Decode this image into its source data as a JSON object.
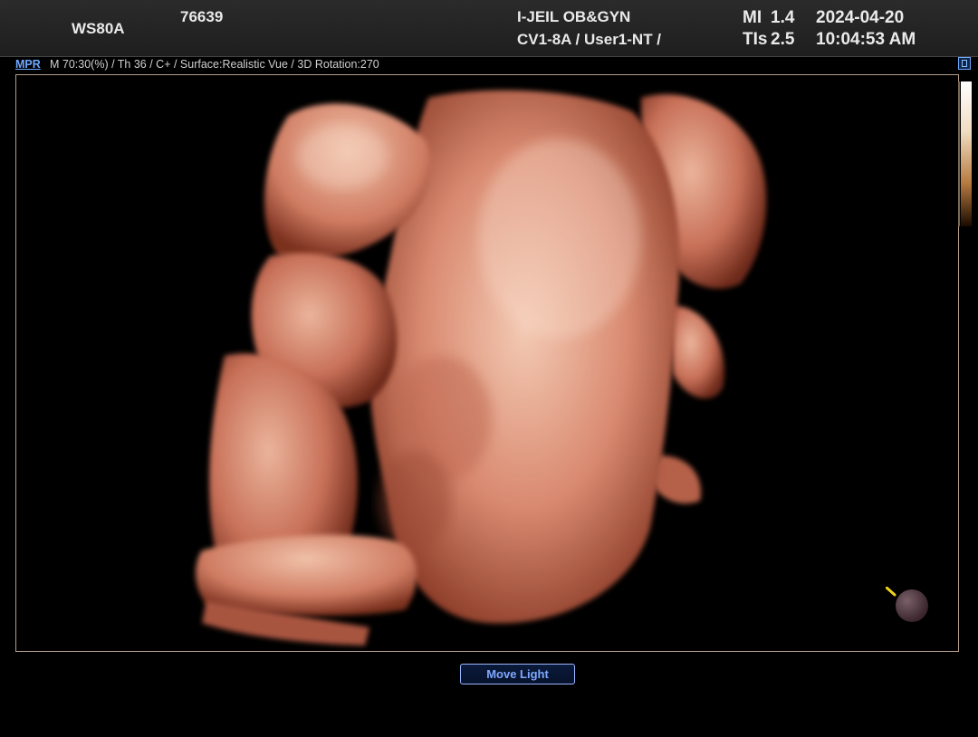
{
  "header": {
    "model": "WS80A",
    "patient_id": "76639",
    "institution": "I-JEIL OB&GYN",
    "probe_preset": "CV1-8A / User1-NT /",
    "mi_label": "MI",
    "mi_value": "1.4",
    "tis_label": "TIs",
    "tis_value": "2.5",
    "date": "2024-04-20",
    "time": "10:04:53 AM"
  },
  "info_bar": {
    "mode": "MPR",
    "params": "M 70:30(%) / Th 36 / C+ / Surface:Realistic Vue / 3D Rotation:270"
  },
  "icons": {
    "corner": "window-toggle-icon",
    "light": "light-source-icon"
  },
  "footer": {
    "button_label": "Move Light"
  },
  "colors": {
    "accent": "#6ea8ff",
    "header_bg": "#262626",
    "skin": "#d98a70"
  }
}
